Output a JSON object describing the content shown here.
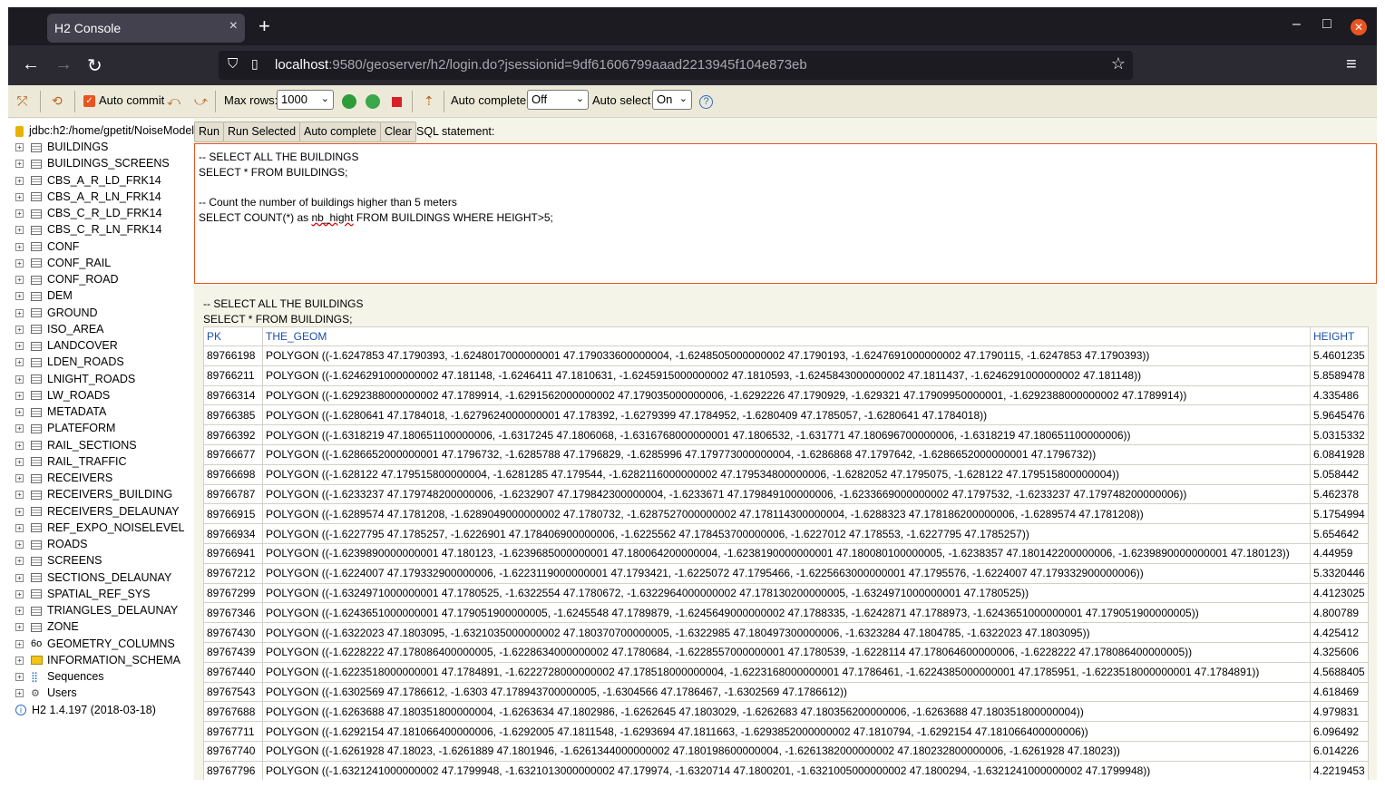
{
  "browser": {
    "tab_title": "H2 Console",
    "tab_close": "×",
    "new_tab": "+",
    "url_host": "localhost",
    "url_path": ":9580/geoserver/h2/login.do?jsessionid=9df61606799aaad2213945f104e873eb",
    "minimize": "–",
    "maximize": "□",
    "close": "✕",
    "back": "←",
    "forward": "→",
    "reload": "↻",
    "menu": "≡",
    "star": "☆",
    "shield": "⛉",
    "page_icon": "▯"
  },
  "toolbar": {
    "auto_commit_label": "Auto commit",
    "max_rows_label": "Max rows:",
    "max_rows_value": "1000",
    "auto_complete_label": "Auto complete",
    "auto_complete_value": "Off",
    "auto_select_label": "Auto select",
    "auto_select_value": "On",
    "help": "?",
    "checkmark": "✓",
    "dropdown_arrow": "⌄"
  },
  "tree": {
    "connection": "jdbc:h2:/home/gpetit/NoiseModel",
    "expander": "+",
    "info": "i",
    "tables": [
      "BUILDINGS",
      "BUILDINGS_SCREENS",
      "CBS_A_R_LD_FRK14",
      "CBS_A_R_LN_FRK14",
      "CBS_C_R_LD_FRK14",
      "CBS_C_R_LN_FRK14",
      "CONF",
      "CONF_RAIL",
      "CONF_ROAD",
      "DEM",
      "GROUND",
      "ISO_AREA",
      "LANDCOVER",
      "LDEN_ROADS",
      "LNIGHT_ROADS",
      "LW_ROADS",
      "METADATA",
      "PLATEFORM",
      "RAIL_SECTIONS",
      "RAIL_TRAFFIC",
      "RECEIVERS",
      "RECEIVERS_BUILDING",
      "RECEIVERS_DELAUNAY",
      "REF_EXPO_NOISELEVEL",
      "ROADS",
      "SCREENS",
      "SECTIONS_DELAUNAY",
      "SPATIAL_REF_SYS",
      "TRIANGLES_DELAUNAY",
      "ZONE"
    ],
    "geometry_columns": "GEOMETRY_COLUMNS",
    "information_schema": "INFORMATION_SCHEMA",
    "sequences": "Sequences",
    "users": "Users",
    "version": "H2 1.4.197 (2018-03-18)",
    "geo_icon": "6o",
    "seq_icon": "⣿",
    "users_icon": "⚙"
  },
  "query_bar": {
    "run": "Run",
    "run_selected": "Run Selected",
    "auto_complete": "Auto complete",
    "clear": "Clear",
    "sql_statement": "SQL statement:"
  },
  "editor": {
    "line1": "-- SELECT ALL THE BUILDINGS",
    "line2": "SELECT * FROM BUILDINGS;",
    "line3": "-- Count the number of buildings higher than 5 meters",
    "line4_pre": "SELECT COUNT(*) as ",
    "line4_squig": "nb_hight",
    "line4_post": " FROM BUILDINGS WHERE HEIGHT>5;"
  },
  "results": {
    "comment": "-- SELECT ALL THE BUILDINGS",
    "query": "SELECT * FROM BUILDINGS;",
    "columns": [
      "PK",
      "THE_GEOM",
      "HEIGHT"
    ],
    "rows": [
      [
        "89766198",
        "POLYGON ((-1.6247853 47.1790393, -1.6248017000000001 47.179033600000004, -1.6248505000000002 47.1790193, -1.6247691000000002 47.1790115, -1.6247853 47.1790393))",
        "5.4601235"
      ],
      [
        "89766211",
        "POLYGON ((-1.6246291000000002 47.181148, -1.6246411 47.1810631, -1.6245915000000002 47.1810593, -1.6245843000000002 47.1811437, -1.6246291000000002 47.181148))",
        "5.8589478"
      ],
      [
        "89766314",
        "POLYGON ((-1.6292388000000002 47.1789914, -1.6291562000000002 47.179035000000006, -1.6292226 47.1790929, -1.629321 47.17909950000001, -1.6292388000000002 47.1789914))",
        "4.335486"
      ],
      [
        "89766385",
        "POLYGON ((-1.6280641 47.1784018, -1.6279624000000001 47.178392, -1.6279399 47.1784952, -1.6280409 47.1785057, -1.6280641 47.1784018))",
        "5.9645476"
      ],
      [
        "89766392",
        "POLYGON ((-1.6318219 47.180651100000006, -1.6317245 47.1806068, -1.6316768000000001 47.1806532, -1.631771 47.180696700000006, -1.6318219 47.180651100000006))",
        "5.0315332"
      ],
      [
        "89766677",
        "POLYGON ((-1.6286652000000001 47.1796732, -1.6285788 47.1796829, -1.6285996 47.179773000000004, -1.6286868 47.1797642, -1.6286652000000001 47.1796732))",
        "6.0841928"
      ],
      [
        "89766698",
        "POLYGON ((-1.628122 47.179515800000004, -1.6281285 47.179544, -1.6282116000000002 47.179534800000006, -1.6282052 47.1795075, -1.628122 47.179515800000004))",
        "5.058442"
      ],
      [
        "89766787",
        "POLYGON ((-1.6233237 47.179748200000006, -1.6232907 47.179842300000004, -1.6233671 47.179849100000006, -1.6233669000000002 47.1797532, -1.6233237 47.179748200000006))",
        "5.462378"
      ],
      [
        "89766915",
        "POLYGON ((-1.6289574 47.1781208, -1.6289049000000002 47.1780732, -1.6287527000000002 47.178114300000004, -1.6288323 47.178186200000006, -1.6289574 47.1781208))",
        "5.1754994"
      ],
      [
        "89766934",
        "POLYGON ((-1.6227795 47.1785257, -1.6226901 47.178406900000006, -1.6225562 47.178453700000006, -1.6227012 47.178553, -1.6227795 47.1785257))",
        "5.654642"
      ],
      [
        "89766941",
        "POLYGON ((-1.6239890000000001 47.180123, -1.6239685000000001 47.180064200000004, -1.6238190000000001 47.180080100000005, -1.6238357 47.180142200000006, -1.6239890000000001 47.180123))",
        "4.44959"
      ],
      [
        "89767212",
        "POLYGON ((-1.6224007 47.179332900000006, -1.6223119000000001 47.1793421, -1.6225072 47.1795466, -1.6225663000000001 47.1795576, -1.6224007 47.179332900000006))",
        "5.3320446"
      ],
      [
        "89767299",
        "POLYGON ((-1.6324971000000001 47.1780525, -1.6322554 47.1780672, -1.6322964000000002 47.178130200000005, -1.6324971000000001 47.1780525))",
        "4.4123025"
      ],
      [
        "89767346",
        "POLYGON ((-1.6243651000000001 47.179051900000005, -1.6245548 47.1789879, -1.6245649000000002 47.1788335, -1.6242871 47.1788973, -1.6243651000000001 47.179051900000005))",
        "4.800789"
      ],
      [
        "89767430",
        "POLYGON ((-1.6322023 47.1803095, -1.6321035000000002 47.180370700000005, -1.6322985 47.180497300000006, -1.6323284 47.1804785, -1.6322023 47.1803095))",
        "4.425412"
      ],
      [
        "89767439",
        "POLYGON ((-1.6228222 47.178086400000005, -1.6228634000000002 47.1780684, -1.6228557000000001 47.1780539, -1.6228114 47.178064600000006, -1.6228222 47.178086400000005))",
        "4.325606"
      ],
      [
        "89767440",
        "POLYGON ((-1.6223518000000001 47.1784891, -1.6222728000000002 47.178518000000004, -1.6223168000000001 47.1786461, -1.6224385000000001 47.1785951, -1.6223518000000001 47.1784891))",
        "4.5688405"
      ],
      [
        "89767543",
        "POLYGON ((-1.6302569 47.1786612, -1.6303 47.178943700000005, -1.6304566 47.1786467, -1.6302569 47.1786612))",
        "4.618469"
      ],
      [
        "89767688",
        "POLYGON ((-1.6263688 47.180351800000004, -1.6263634 47.1802986, -1.6262645 47.1803029, -1.6262683 47.180356200000006, -1.6263688 47.180351800000004))",
        "4.979831"
      ],
      [
        "89767711",
        "POLYGON ((-1.6292154 47.181066400000006, -1.6292005 47.1811548, -1.6293694 47.1811663, -1.6293852000000002 47.1810794, -1.6292154 47.181066400000006))",
        "6.096492"
      ],
      [
        "89767740",
        "POLYGON ((-1.6261928 47.18023, -1.6261889 47.1801946, -1.6261344000000002 47.180198600000004, -1.6261382000000002 47.180232800000006, -1.6261928 47.18023))",
        "6.014226"
      ],
      [
        "89767796",
        "POLYGON ((-1.6321241000000002 47.1799948, -1.6321013000000002 47.179974, -1.6320714 47.1800201, -1.6321005000000002 47.1800294, -1.6321241000000002 47.1799948))",
        "4.2219453"
      ]
    ]
  }
}
